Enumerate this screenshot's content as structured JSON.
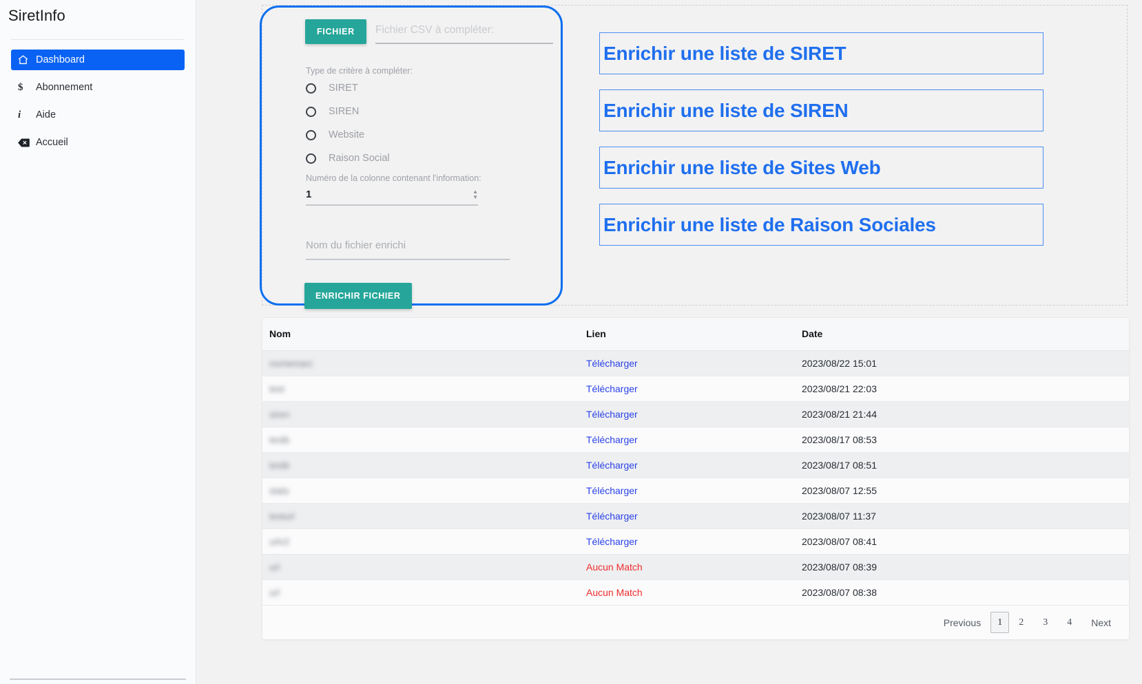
{
  "sidebar": {
    "brand": "SiretInfo",
    "items": [
      {
        "label": "Dashboard",
        "icon": "home-icon",
        "active": true
      },
      {
        "label": "Abonnement",
        "icon": "dollar-icon",
        "active": false
      },
      {
        "label": "Aide",
        "icon": "info-icon",
        "active": false
      },
      {
        "label": "Accueil",
        "icon": "backspace-icon",
        "active": false
      }
    ]
  },
  "form": {
    "file_button_label": "FICHIER",
    "file_placeholder": "Fichier CSV à compléter:",
    "file_value": "",
    "criteria_label": "Type de critère à compléter:",
    "criteria_options": [
      "SIRET",
      "SIREN",
      "Website",
      "Raison Social"
    ],
    "criteria_selected": "",
    "column_label": "Numéro de la colonne contenant l'information:",
    "column_value": "1",
    "output_name_placeholder": "Nom du fichier enrichi",
    "output_name_value": "",
    "submit_label": "ENRICHIR FICHIER"
  },
  "headlines": [
    "Enrichir une liste de SIRET",
    "Enrichir une liste de SIREN",
    "Enrichir une liste de Sites Web",
    "Enrichir une liste de Raison Sociales"
  ],
  "table": {
    "columns": [
      "Nom",
      "Lien",
      "Date"
    ],
    "rows": [
      {
        "nom": "nomemarc",
        "lien": "Télécharger",
        "lien_type": "download",
        "date": "2023/08/22 15:01"
      },
      {
        "nom": "test",
        "lien": "Télécharger",
        "lien_type": "download",
        "date": "2023/08/21 22:03"
      },
      {
        "nom": "siren",
        "lien": "Télécharger",
        "lien_type": "download",
        "date": "2023/08/21 21:44"
      },
      {
        "nom": "testb",
        "lien": "Télécharger",
        "lien_type": "download",
        "date": "2023/08/17 08:53"
      },
      {
        "nom": "testb",
        "lien": "Télécharger",
        "lien_type": "download",
        "date": "2023/08/17 08:51"
      },
      {
        "nom": "stats",
        "lien": "Télécharger",
        "lien_type": "download",
        "date": "2023/08/07 12:55"
      },
      {
        "nom": "testurl",
        "lien": "Télécharger",
        "lien_type": "download",
        "date": "2023/08/07 11:37"
      },
      {
        "nom": "urlv2",
        "lien": "Télécharger",
        "lien_type": "download",
        "date": "2023/08/07 08:41"
      },
      {
        "nom": "url",
        "lien": "Aucun Match",
        "lien_type": "nomatch",
        "date": "2023/08/07 08:39"
      },
      {
        "nom": "url",
        "lien": "Aucun Match",
        "lien_type": "nomatch",
        "date": "2023/08/07 08:38"
      }
    ]
  },
  "pagination": {
    "previous_label": "Previous",
    "next_label": "Next",
    "pages": [
      "1",
      "2",
      "3",
      "4"
    ],
    "current_page": "1"
  },
  "colors": {
    "accent_blue": "#0a62f4",
    "teal": "#26a69a",
    "link_blue": "#2a42e8",
    "error_red": "#ef2b2b",
    "headline_blue": "#1f6fee"
  }
}
